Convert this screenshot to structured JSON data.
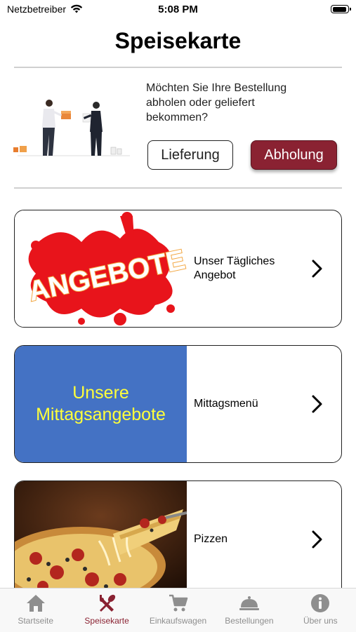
{
  "status_bar": {
    "carrier": "Netzbetreiber",
    "time": "5:08 PM"
  },
  "header": {
    "title": "Speisekarte"
  },
  "delivery": {
    "question": "Möchten Sie Ihre Bestellung abholen oder geliefert bekommen?",
    "lieferung_label": "Lieferung",
    "abholung_label": "Abholung"
  },
  "cards": [
    {
      "image_text": "ANGEBOTE",
      "label": "Unser Tägliches Angebot"
    },
    {
      "image_text": "Unsere Mittagsangebote",
      "label": "Mittagsmenü"
    },
    {
      "image_text": "",
      "label": "Pizzen"
    }
  ],
  "tabbar": [
    {
      "label": "Startseite",
      "icon": "home-icon"
    },
    {
      "label": "Speisekarte",
      "icon": "fork-spoon-icon",
      "active": true
    },
    {
      "label": "Einkaufswagen",
      "icon": "cart-icon"
    },
    {
      "label": "Bestellungen",
      "icon": "cloche-icon"
    },
    {
      "label": "Über uns",
      "icon": "info-icon"
    }
  ],
  "colors": {
    "accent": "#8a2232",
    "mittag_bg": "#4472c4",
    "mittag_text": "#ffff3a",
    "inactive_tab": "#8e8e8e"
  }
}
